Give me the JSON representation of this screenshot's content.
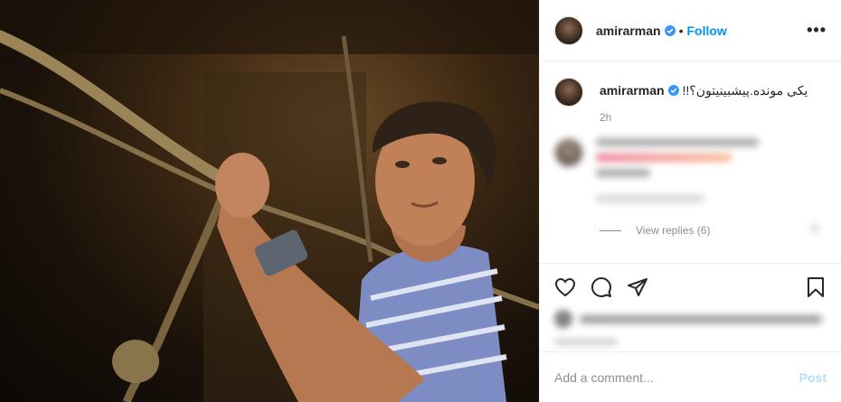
{
  "header": {
    "username": "amirarman",
    "separator": "•",
    "follow_label": "Follow",
    "more_label": "•••"
  },
  "caption": {
    "username": "amirarman",
    "text": "!!یکی مونده.پیشبینیتون؟",
    "time": "2h"
  },
  "comment": {
    "view_replies": "View replies (6)"
  },
  "composer": {
    "placeholder": "Add a comment...",
    "post_label": "Post"
  },
  "icons": {
    "verified": "verified-badge-icon",
    "like": "heart-icon",
    "comment": "comment-bubble-icon",
    "share": "paper-plane-icon",
    "save": "bookmark-icon",
    "more": "ellipsis-icon"
  },
  "colors": {
    "accent": "#0095f6",
    "post_disabled": "#b2dffc",
    "muted": "#8e8e8e"
  }
}
